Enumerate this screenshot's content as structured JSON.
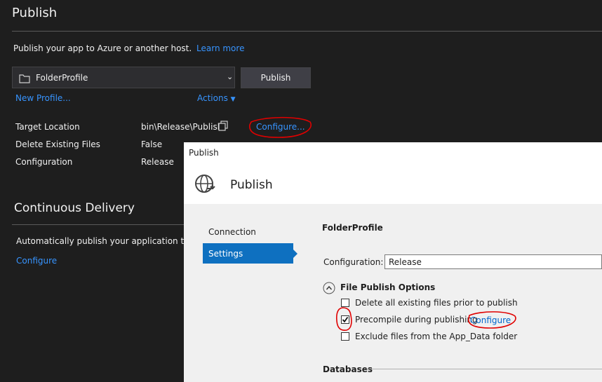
{
  "page": {
    "title": "Publish",
    "subtitle": "Publish your app to Azure or another host.",
    "learn_more": "Learn more",
    "profile_select": "FolderProfile",
    "publish_button": "Publish",
    "new_profile": "New Profile...",
    "actions": "Actions",
    "summary": [
      {
        "label": "Target Location",
        "value": "bin\\Release\\Publish"
      },
      {
        "label": "Delete Existing Files",
        "value": "False"
      },
      {
        "label": "Configuration",
        "value": "Release"
      }
    ],
    "configure_link": "Configure...",
    "cd_title": "Continuous Delivery",
    "cd_text": "Automatically publish your application to Azu",
    "cd_configure": "Configure"
  },
  "dialog": {
    "window_title": "Publish",
    "header_title": "Publish",
    "nav": [
      {
        "label": "Connection",
        "selected": false
      },
      {
        "label": "Settings",
        "selected": true
      }
    ],
    "profile_name": "FolderProfile",
    "configuration_label": "Configuration:",
    "configuration_value": "Release",
    "file_publish_options": "File Publish Options",
    "options": [
      {
        "label": "Delete all existing files prior to publish",
        "checked": false
      },
      {
        "label": "Precompile during publishing",
        "checked": true
      },
      {
        "label": "Exclude files from the App_Data folder",
        "checked": false
      }
    ],
    "precompile_configure": "Configure",
    "databases": "Databases"
  },
  "colors": {
    "dark_bg": "#1e1e1e",
    "link": "#3794ff",
    "selected_nav": "#0e70c0",
    "annotation": "#e00000"
  },
  "icons": {
    "folder": "folder-icon",
    "dropdown": "chevron-down-icon",
    "actions_caret": "caret-down-icon",
    "copy": "copy-icon",
    "globe": "globe-publish-icon",
    "collapse": "chevron-up-circle-icon",
    "nav_pointer": "triangle-right-icon"
  }
}
